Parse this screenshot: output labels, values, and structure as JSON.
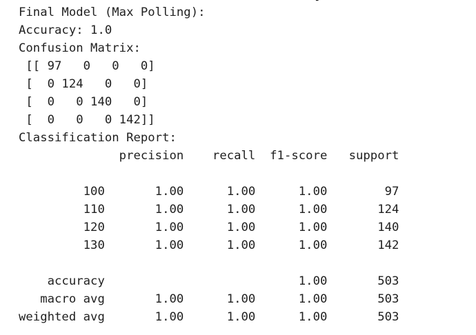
{
  "cell_output": {
    "clipped_top_line": "]",
    "lines": [
      "Final Model (Max Polling):",
      "Accuracy: 1.0",
      "Confusion Matrix:",
      " [[ 97   0   0   0]",
      " [  0 124   0   0]",
      " [  0   0 140   0]",
      " [  0   0   0 142]]",
      "Classification Report:",
      "              precision    recall  f1-score   support",
      "",
      "         100       1.00      1.00      1.00        97",
      "         110       1.00      1.00      1.00       124",
      "         120       1.00      1.00      1.00       140",
      "         130       1.00      1.00      1.00       142",
      "",
      "    accuracy                           1.00       503",
      "   macro avg       1.00      1.00      1.00       503",
      "weighted avg       1.00      1.00      1.00       503"
    ]
  }
}
